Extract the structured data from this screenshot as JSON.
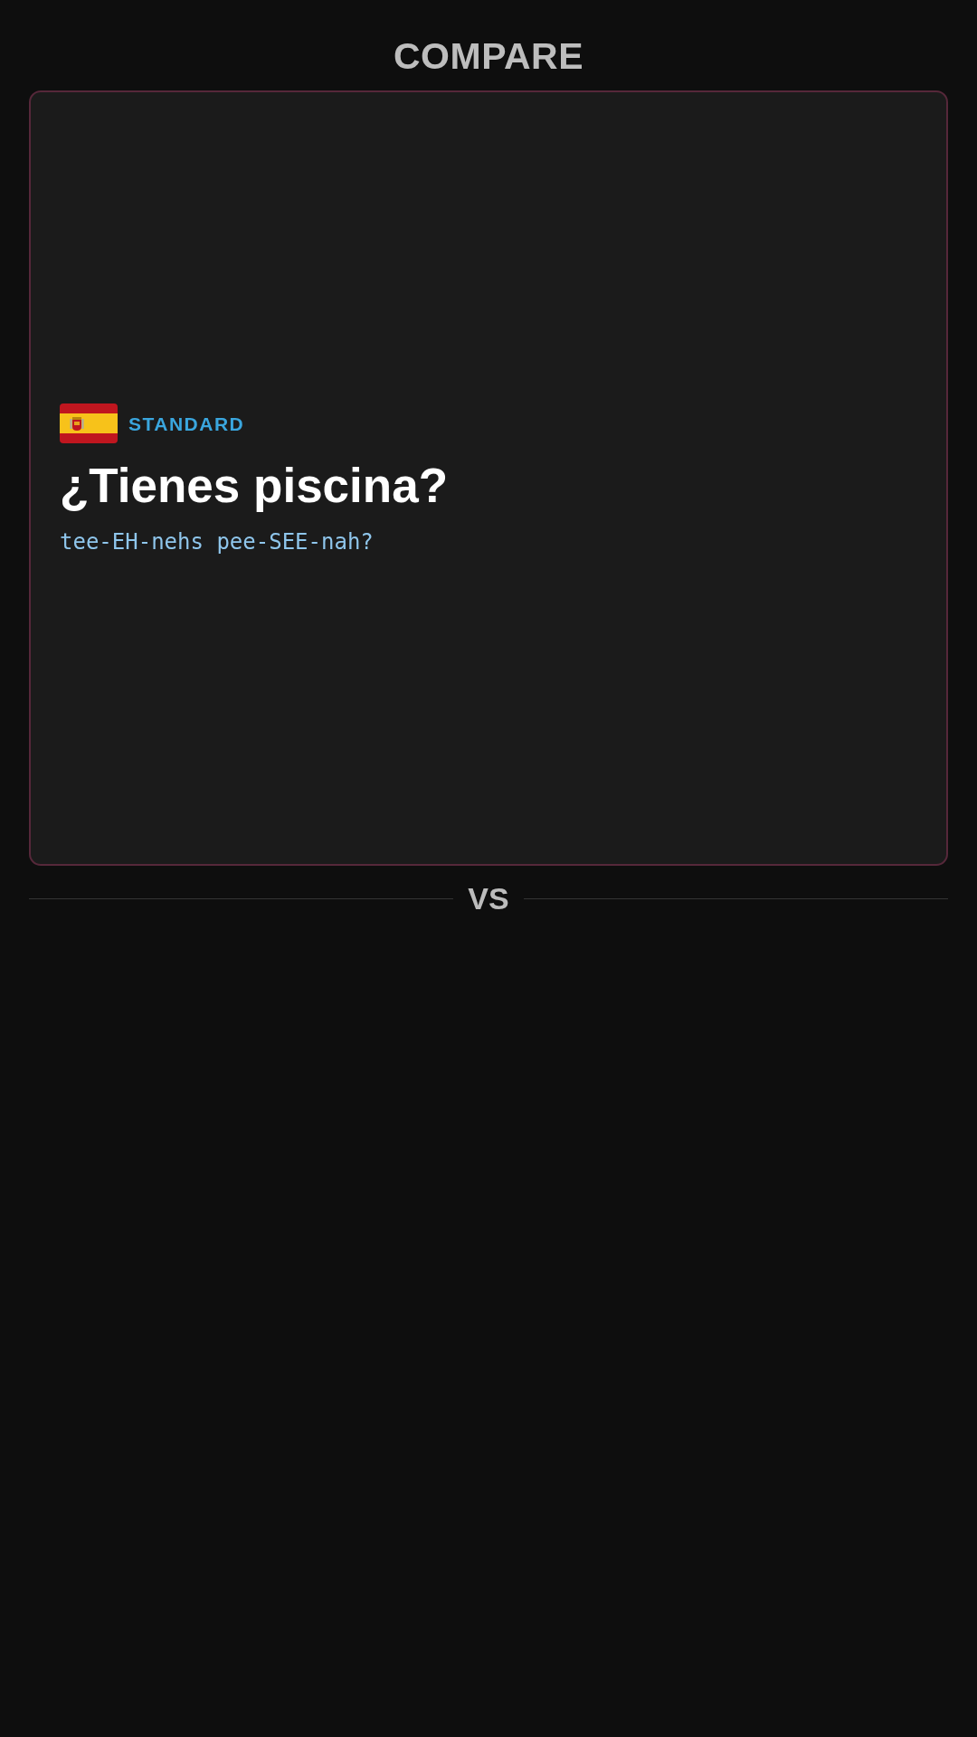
{
  "header": {
    "title": "COMPARE"
  },
  "card": {
    "dialect": "STANDARD",
    "phrase": "¿Tienes piscina?",
    "pronunciation": "tee-EH-nehs pee-SEE-nah?"
  },
  "divider": {
    "label": "VS"
  }
}
